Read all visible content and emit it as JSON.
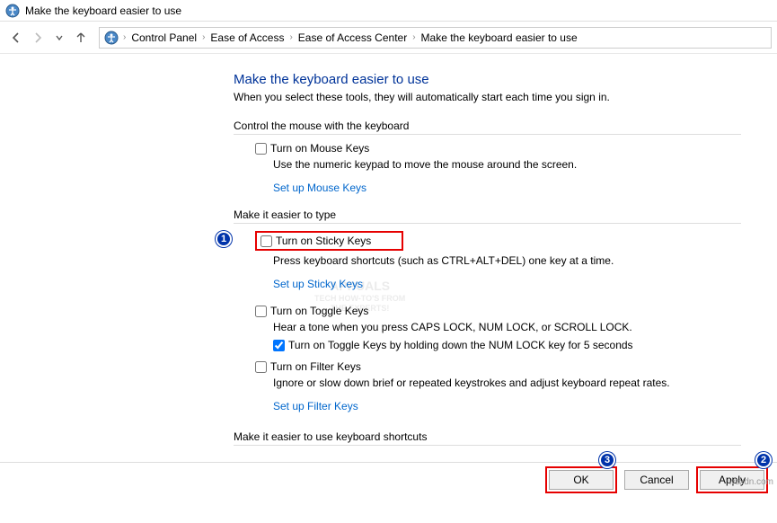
{
  "titlebar": {
    "title": "Make the keyboard easier to use"
  },
  "breadcrumb": {
    "items": [
      "Control Panel",
      "Ease of Access",
      "Ease of Access Center",
      "Make the keyboard easier to use"
    ]
  },
  "page": {
    "heading": "Make the keyboard easier to use",
    "subheading": "When you select these tools, they will automatically start each time you sign in."
  },
  "section_mouse": {
    "header": "Control the mouse with the keyboard",
    "mouse_keys": {
      "label": "Turn on Mouse Keys",
      "checked": false,
      "desc": "Use the numeric keypad to move the mouse around the screen."
    },
    "link": "Set up Mouse Keys"
  },
  "section_type": {
    "header": "Make it easier to type",
    "sticky": {
      "label": "Turn on Sticky Keys",
      "checked": false,
      "desc": "Press keyboard shortcuts (such as CTRL+ALT+DEL) one key at a time.",
      "link": "Set up Sticky Keys"
    },
    "toggle": {
      "label": "Turn on Toggle Keys",
      "checked": false,
      "desc": "Hear a tone when you press CAPS LOCK, NUM LOCK, or SCROLL LOCK.",
      "sub_label": "Turn on Toggle Keys by holding down the NUM LOCK key for 5 seconds",
      "sub_checked": true
    },
    "filter": {
      "label": "Turn on Filter Keys",
      "checked": false,
      "desc": "Ignore or slow down brief or repeated keystrokes and adjust keyboard repeat rates.",
      "link": "Set up Filter Keys"
    }
  },
  "section_shortcuts": {
    "header": "Make it easier to use keyboard shortcuts"
  },
  "buttons": {
    "ok": "OK",
    "cancel": "Cancel",
    "apply": "Apply"
  },
  "callouts": {
    "c1": "1",
    "c2": "2",
    "c3": "3"
  },
  "watermark": {
    "line1": "APPUALS",
    "line2": "TECH HOW-TO'S FROM",
    "line3": "THE EXPERTS!"
  },
  "corner": "wsxdn.com"
}
